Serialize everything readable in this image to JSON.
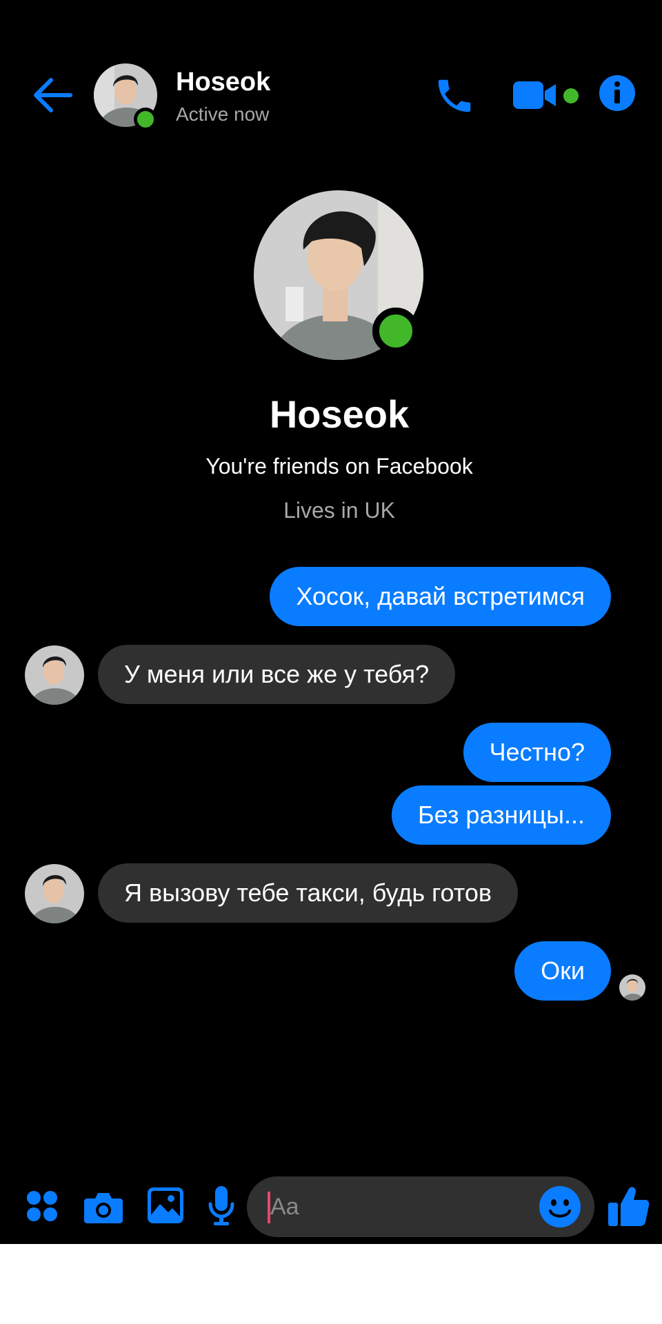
{
  "header": {
    "name": "Hoseok",
    "status": "Active now"
  },
  "profile": {
    "name": "Hoseok",
    "friends_text": "You're friends on Facebook",
    "location_text": "Lives in UK"
  },
  "messages": [
    {
      "direction": "out",
      "text": "Хосок, давай встретимся"
    },
    {
      "direction": "in",
      "text": "У меня или все же у тебя?"
    },
    {
      "direction": "out",
      "text": "Честно?"
    },
    {
      "direction": "out",
      "text": "Без разницы..."
    },
    {
      "direction": "in",
      "text": "Я вызову тебе такси, будь готов"
    },
    {
      "direction": "out",
      "text": "Оки"
    }
  ],
  "composer": {
    "placeholder": "Aa"
  },
  "colors": {
    "accent": "#0a7cff",
    "online": "#42b72a",
    "incoming_bubble": "#303030",
    "background": "#000000"
  },
  "icons": [
    "back-arrow-icon",
    "phone-icon",
    "video-camera-icon",
    "info-icon",
    "apps-grid-icon",
    "camera-icon",
    "gallery-icon",
    "microphone-icon",
    "emoji-icon",
    "thumbs-up-icon"
  ]
}
